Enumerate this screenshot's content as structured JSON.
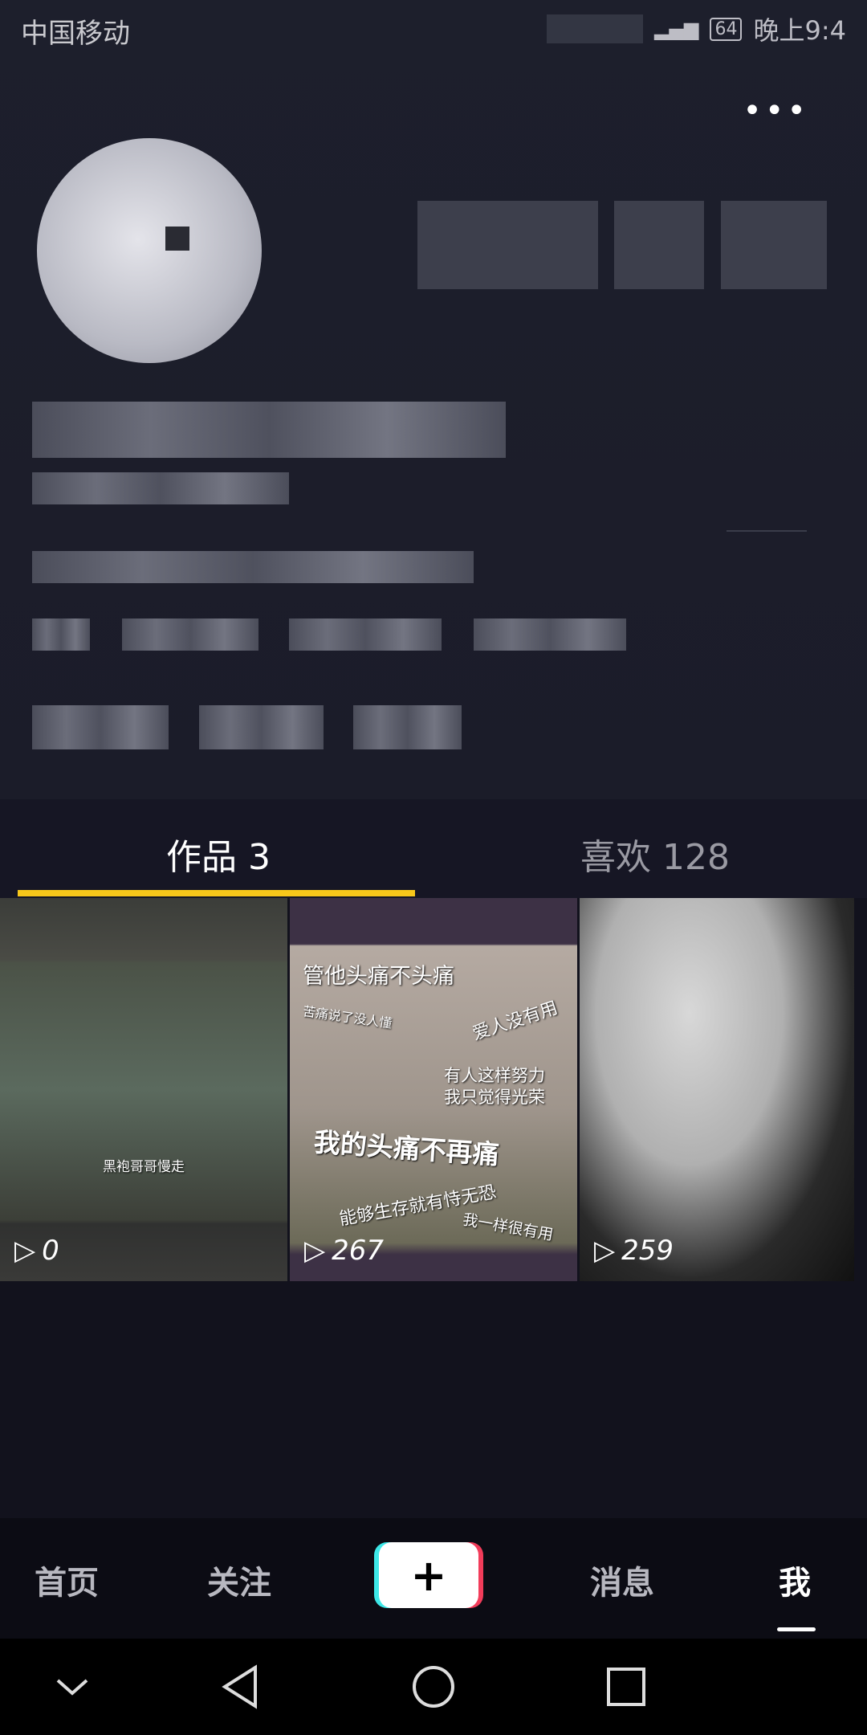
{
  "status_bar": {
    "carrier": "中国移动",
    "battery": "64",
    "time": "晚上9:4"
  },
  "header": {
    "more_icon": "ellipsis-icon"
  },
  "tabs": [
    {
      "label": "作品 3",
      "active": true
    },
    {
      "label": "喜欢 128",
      "active": false
    }
  ],
  "colors": {
    "accent": "#f7c71a",
    "background": "#12121d",
    "header": "#1d1f2c"
  },
  "videos": [
    {
      "plays": "0",
      "captions": [
        "黑袍哥哥慢走"
      ]
    },
    {
      "plays": "267",
      "captions": [
        "管他头痛不头痛",
        "苦痛说了没人懂",
        "爱人没有用",
        "有人这样努力",
        "我只觉得光荣",
        "我的头痛不再痛",
        "能够生存就有恃无恐",
        "我一样很有用"
      ]
    },
    {
      "plays": "259",
      "captions": []
    }
  ],
  "bottom_nav": {
    "items": [
      {
        "label": "首页"
      },
      {
        "label": "关注"
      },
      {
        "label": "+"
      },
      {
        "label": "消息"
      },
      {
        "label": "我",
        "active": true
      }
    ]
  },
  "system_nav": [
    "back-chevron-icon",
    "back-triangle-icon",
    "home-circle-icon",
    "recents-square-icon"
  ]
}
